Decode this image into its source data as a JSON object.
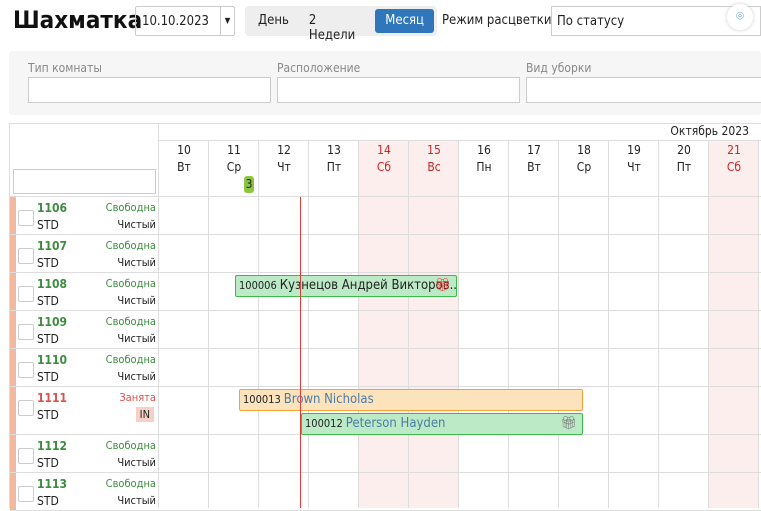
{
  "header": {
    "title": "Шахматка",
    "date": "10.10.2023",
    "views": [
      "День",
      "2 Недели",
      "Месяц"
    ],
    "active_view": "Месяц",
    "color_mode_label": "Режим расцветки",
    "color_mode_value": "По статусу"
  },
  "filters": [
    {
      "label": "Тип комнаты",
      "value": ""
    },
    {
      "label": "Расположение",
      "value": ""
    },
    {
      "label": "Вид уборки",
      "value": ""
    }
  ],
  "calendar": {
    "month": "Октябрь 2023",
    "days": [
      {
        "d": "10",
        "w": "Вт",
        "we": false
      },
      {
        "d": "11",
        "w": "Ср",
        "we": false,
        "badge": "3"
      },
      {
        "d": "12",
        "w": "Чт",
        "we": false
      },
      {
        "d": "13",
        "w": "Пт",
        "we": false
      },
      {
        "d": "14",
        "w": "Сб",
        "we": true
      },
      {
        "d": "15",
        "w": "Вс",
        "we": true
      },
      {
        "d": "16",
        "w": "Пн",
        "we": false
      },
      {
        "d": "17",
        "w": "Вт",
        "we": false
      },
      {
        "d": "18",
        "w": "Ср",
        "we": false
      },
      {
        "d": "19",
        "w": "Чт",
        "we": false
      },
      {
        "d": "20",
        "w": "Пт",
        "we": false
      },
      {
        "d": "21",
        "w": "Сб",
        "we": true
      }
    ],
    "today": "12"
  },
  "rooms": [
    {
      "num": "1106",
      "type": "STD",
      "status": "Свободна",
      "clean": "Чистый"
    },
    {
      "num": "1107",
      "type": "STD",
      "status": "Свободна",
      "clean": "Чистый"
    },
    {
      "num": "1108",
      "type": "STD",
      "status": "Свободна",
      "clean": "Чистый"
    },
    {
      "num": "1109",
      "type": "STD",
      "status": "Свободна",
      "clean": "Чистый"
    },
    {
      "num": "1110",
      "type": "STD",
      "status": "Свободна",
      "clean": "Чистый"
    },
    {
      "num": "1111",
      "type": "STD",
      "status": "Занята",
      "clean": "IN"
    },
    {
      "num": "1112",
      "type": "STD",
      "status": "Свободна",
      "clean": "Чистый"
    },
    {
      "num": "1113",
      "type": "STD",
      "status": "Свободна",
      "clean": "Чистый"
    }
  ],
  "bookings": [
    {
      "id": "100006",
      "guest": "Кузнецов Андрей Викторов...",
      "room": "1108",
      "color": "green",
      "gift": "red"
    },
    {
      "id": "100013",
      "guest": "Brown Nicholas",
      "room": "1111",
      "color": "orange"
    },
    {
      "id": "100012",
      "guest": "Peterson Hayden",
      "room": "1111",
      "color": "green",
      "gift": "gray"
    }
  ]
}
